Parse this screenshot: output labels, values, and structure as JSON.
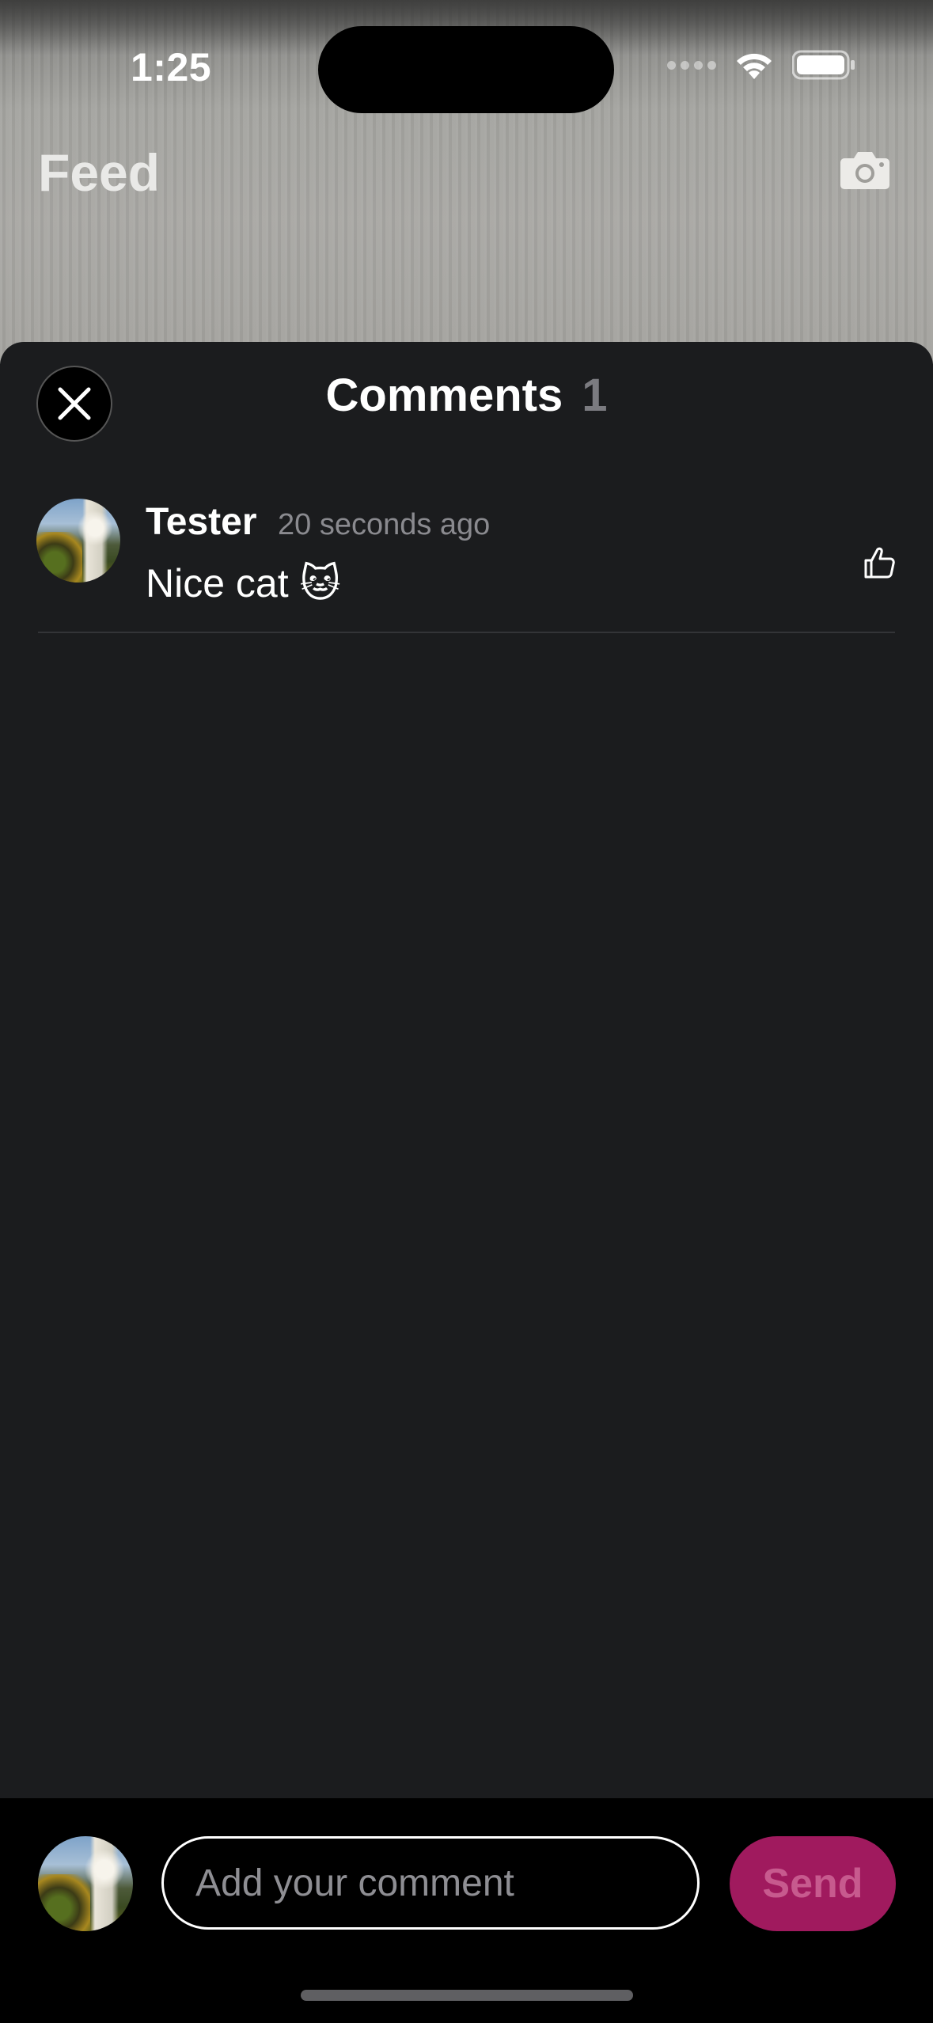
{
  "status_bar": {
    "time": "1:25"
  },
  "feed": {
    "title": "Feed",
    "camera_icon": "camera-icon"
  },
  "comments_sheet": {
    "title": "Comments",
    "count": "1",
    "close_icon": "close-icon",
    "comments": [
      {
        "author": "Tester",
        "time": "20 seconds ago",
        "text": "Nice cat 🐱",
        "like_icon": "thumbs-up-icon"
      }
    ]
  },
  "composer": {
    "placeholder": "Add your comment",
    "send_label": "Send",
    "send_color": "#a01a5e"
  }
}
